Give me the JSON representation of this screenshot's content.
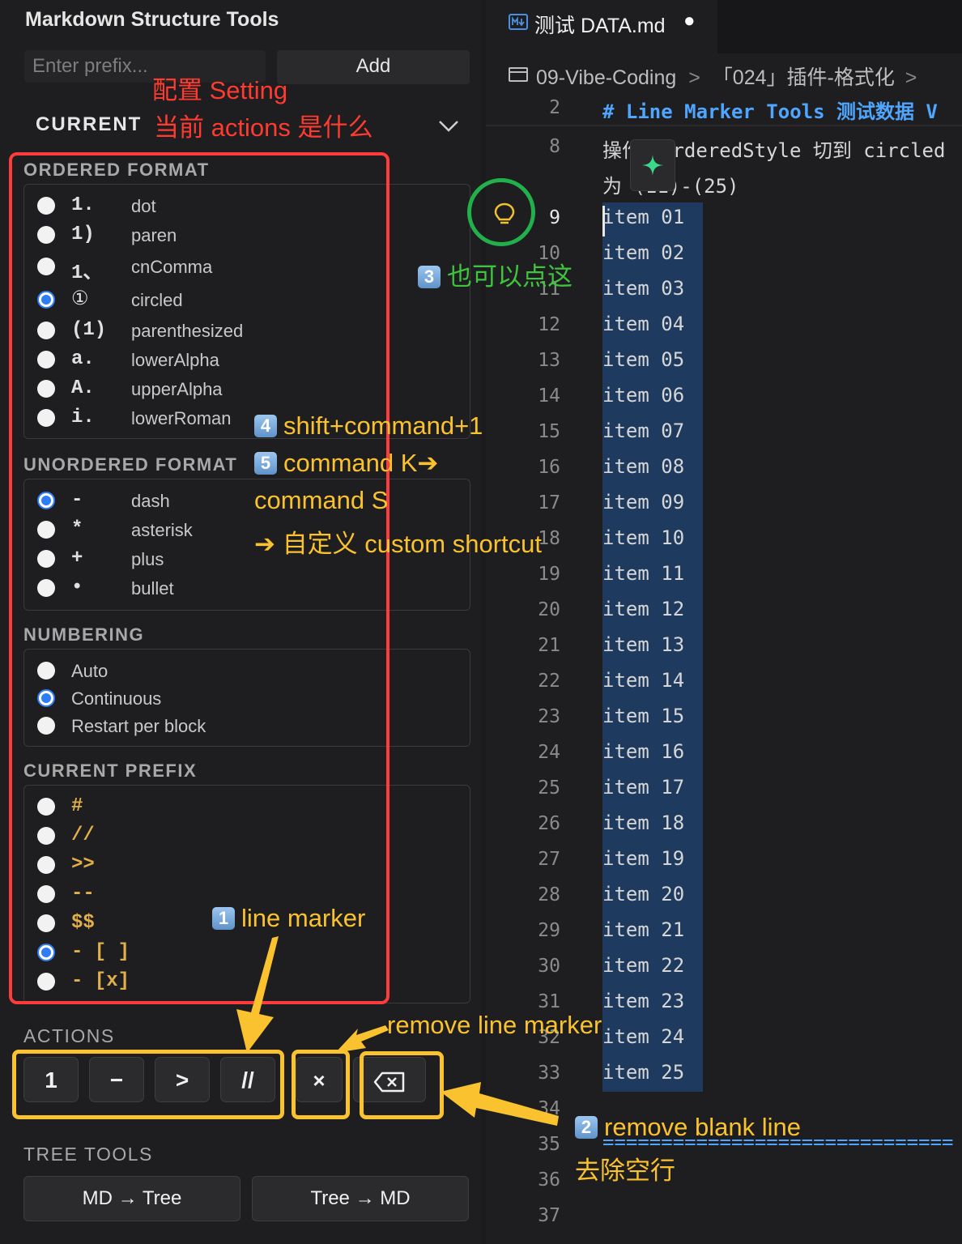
{
  "panel": {
    "title": "Markdown Structure Tools",
    "prefix_placeholder": "Enter prefix...",
    "add_label": "Add",
    "current_label": "CURRENT"
  },
  "ordered": {
    "heading": "ORDERED FORMAT",
    "options": [
      {
        "symbol": "1.",
        "label": "dot",
        "selected": false
      },
      {
        "symbol": "1)",
        "label": "paren",
        "selected": false
      },
      {
        "symbol": "1、",
        "label": "cnComma",
        "selected": false
      },
      {
        "symbol": "①",
        "label": "circled",
        "selected": true
      },
      {
        "symbol": "(1)",
        "label": "parenthesized",
        "selected": false
      },
      {
        "symbol": "a.",
        "label": "lowerAlpha",
        "selected": false
      },
      {
        "symbol": "A.",
        "label": "upperAlpha",
        "selected": false
      },
      {
        "symbol": "i.",
        "label": "lowerRoman",
        "selected": false
      }
    ]
  },
  "unordered": {
    "heading": "UNORDERED FORMAT",
    "options": [
      {
        "symbol": "-",
        "label": "dash",
        "selected": true
      },
      {
        "symbol": "*",
        "label": "asterisk",
        "selected": false
      },
      {
        "symbol": "+",
        "label": "plus",
        "selected": false
      },
      {
        "symbol": "•",
        "label": "bullet",
        "selected": false
      }
    ]
  },
  "numbering": {
    "heading": "NUMBERING",
    "options": [
      {
        "label": "Auto",
        "selected": false
      },
      {
        "label": "Continuous",
        "selected": true
      },
      {
        "label": "Restart per block",
        "selected": false
      }
    ]
  },
  "prefix": {
    "heading": "CURRENT PREFIX",
    "options": [
      {
        "symbol": "#",
        "selected": false
      },
      {
        "symbol": "//",
        "selected": false
      },
      {
        "symbol": ">>",
        "selected": false
      },
      {
        "symbol": "--",
        "selected": false
      },
      {
        "symbol": "$$",
        "selected": false
      },
      {
        "symbol": "- [ ]",
        "selected": true
      },
      {
        "symbol": "- [x]",
        "selected": false
      }
    ]
  },
  "actions": {
    "heading": "ACTIONS",
    "buttons": [
      "1",
      "−",
      ">",
      "//",
      "×",
      "⌫"
    ]
  },
  "tree": {
    "heading": "TREE TOOLS",
    "md_to_tree": "MD → Tree",
    "tree_to_md": "Tree → MD"
  },
  "editor": {
    "tab_title": "测试 DATA.md",
    "tab_modified_dot": "●",
    "breadcrumb_1": "09-Vibe-Coding",
    "breadcrumb_2": "「024」插件-格式化",
    "sep": ">",
    "heading_line": {
      "number": "2",
      "text": "# Line Marker Tools 测试数据 V"
    },
    "line8": {
      "number": "8",
      "text": "操作：orderedStyle 切到 circled",
      "text_cont": "为 (11)-(25)"
    },
    "items": [
      {
        "n": "9",
        "text": "item 01"
      },
      {
        "n": "10",
        "text": "item 02"
      },
      {
        "n": "11",
        "text": "item 03"
      },
      {
        "n": "12",
        "text": "item 04"
      },
      {
        "n": "13",
        "text": "item 05"
      },
      {
        "n": "14",
        "text": "item 06"
      },
      {
        "n": "15",
        "text": "item 07"
      },
      {
        "n": "16",
        "text": "item 08"
      },
      {
        "n": "17",
        "text": "item 09"
      },
      {
        "n": "18",
        "text": "item 10"
      },
      {
        "n": "19",
        "text": "item 11"
      },
      {
        "n": "20",
        "text": "item 12"
      },
      {
        "n": "21",
        "text": "item 13"
      },
      {
        "n": "22",
        "text": "item 14"
      },
      {
        "n": "23",
        "text": "item 15"
      },
      {
        "n": "24",
        "text": "item 16"
      },
      {
        "n": "25",
        "text": "item 17"
      },
      {
        "n": "26",
        "text": "item 18"
      },
      {
        "n": "27",
        "text": "item 19"
      },
      {
        "n": "28",
        "text": "item 20"
      },
      {
        "n": "29",
        "text": "item 21"
      },
      {
        "n": "30",
        "text": "item 22"
      },
      {
        "n": "31",
        "text": "item 23"
      },
      {
        "n": "32",
        "text": "item 24"
      },
      {
        "n": "33",
        "text": "item 25"
      }
    ],
    "trailing_lines": [
      "34",
      "35",
      "36",
      "37"
    ],
    "line35_text": "=============================="
  },
  "annotations": {
    "setting_1": "配置 Setting",
    "setting_2": "当前 actions 是什么",
    "click_here": "也可以点这",
    "shortcut_1": "shift+command+1",
    "shortcut_2": "command K➔",
    "shortcut_3": "command S",
    "shortcut_4": "➔ 自定义 custom shortcut",
    "line_marker": "line marker",
    "remove_marker": "remove line marker",
    "remove_blank_1": "remove blank line",
    "remove_blank_2": "去除空行",
    "badge_1": "1",
    "badge_2": "2",
    "badge_3": "3",
    "badge_4": "4",
    "badge_5": "5"
  },
  "colors": {
    "annotation_red": "#ff3b30",
    "annotation_yellow": "#f9c22e",
    "annotation_green": "#3ec43e",
    "radio_selected": "#2e7cf6",
    "heading_blue": "#4ea6ff"
  }
}
